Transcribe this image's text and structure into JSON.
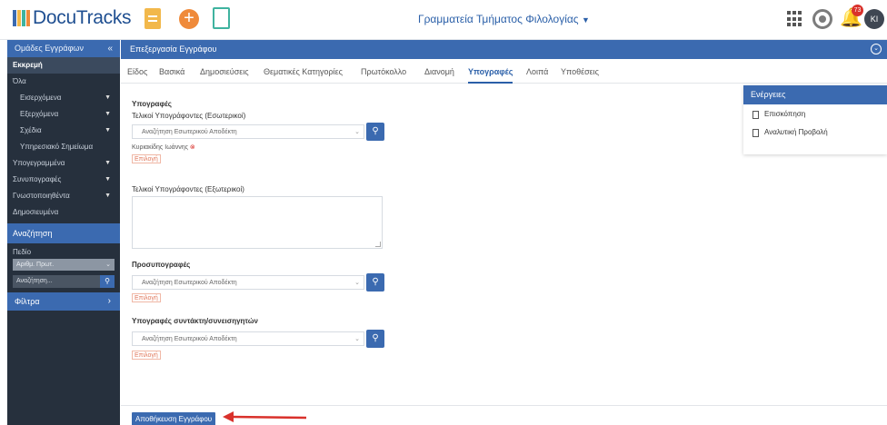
{
  "app": {
    "name": "DocuTracks",
    "department": "Γραμματεία Τμήματος Φιλολογίας",
    "notifications": "73",
    "avatar_initials": "KI"
  },
  "colors": {
    "primary": "#3b6ab0",
    "sidebar_bg": "#26303d",
    "accent_orange": "#ef8a3a",
    "danger": "#d9312b"
  },
  "sidebar": {
    "header": "Ομάδες Εγγράφων",
    "collapse_icon": "double-chevron-left-icon",
    "items": [
      {
        "label": "Εκκρεμή",
        "active": true
      },
      {
        "label": "Όλα"
      },
      {
        "label": "Εισερχόμενα",
        "sub": true
      },
      {
        "label": "Εξερχόμενα",
        "sub": true
      },
      {
        "label": "Σχέδια",
        "sub": true
      },
      {
        "label": "Υπηρεσιακό Σημείωμα",
        "sub": true
      },
      {
        "label": "Υπογεγραμμένα"
      },
      {
        "label": "Συνυπογραφές"
      },
      {
        "label": "Γνωστοποιηθέντα"
      },
      {
        "label": "Δημοσιευμένα"
      }
    ],
    "search_header": "Αναζήτηση",
    "field_label": "Πεδίο",
    "field_value": "Αριθμ. Πρωτ.",
    "search_placeholder": "Αναζήτηση...",
    "filters_label": "Φίλτρα"
  },
  "main": {
    "title": "Επεξεργασία Εγγράφου",
    "tabs": [
      "Είδος",
      "Βασικά",
      "Δημοσιεύσεις",
      "Θεματικές Κατηγορίες",
      "Πρωτόκολλο",
      "Διανομή",
      "Υπογραφές",
      "Λοιπά",
      "Υποθέσεις"
    ],
    "active_tab": "Υπογραφές",
    "section_title": "Υπογραφές",
    "internal_signers_label": "Τελικοί Υπογράφοντες (Εσωτερικοί)",
    "select_placeholder": "Αναζήτηση Εσωτερικού Αποδέκτη",
    "signer_name": "Κυριακίδης Ιωάννης",
    "choose_label": "Επιλογή",
    "external_signers_label": "Τελικοί Υπογράφοντες (Εξωτερικοί)",
    "presign_label": "Προσυπογραφές",
    "coauthors_label": "Υπογραφές συντάκτη/συνεισηγητών",
    "save_button": "Αποθήκευση Εγγράφου"
  },
  "actions_panel": {
    "title": "Ενέργειες",
    "items": [
      "Επισκόπηση",
      "Αναλυτική Προβολή"
    ]
  }
}
